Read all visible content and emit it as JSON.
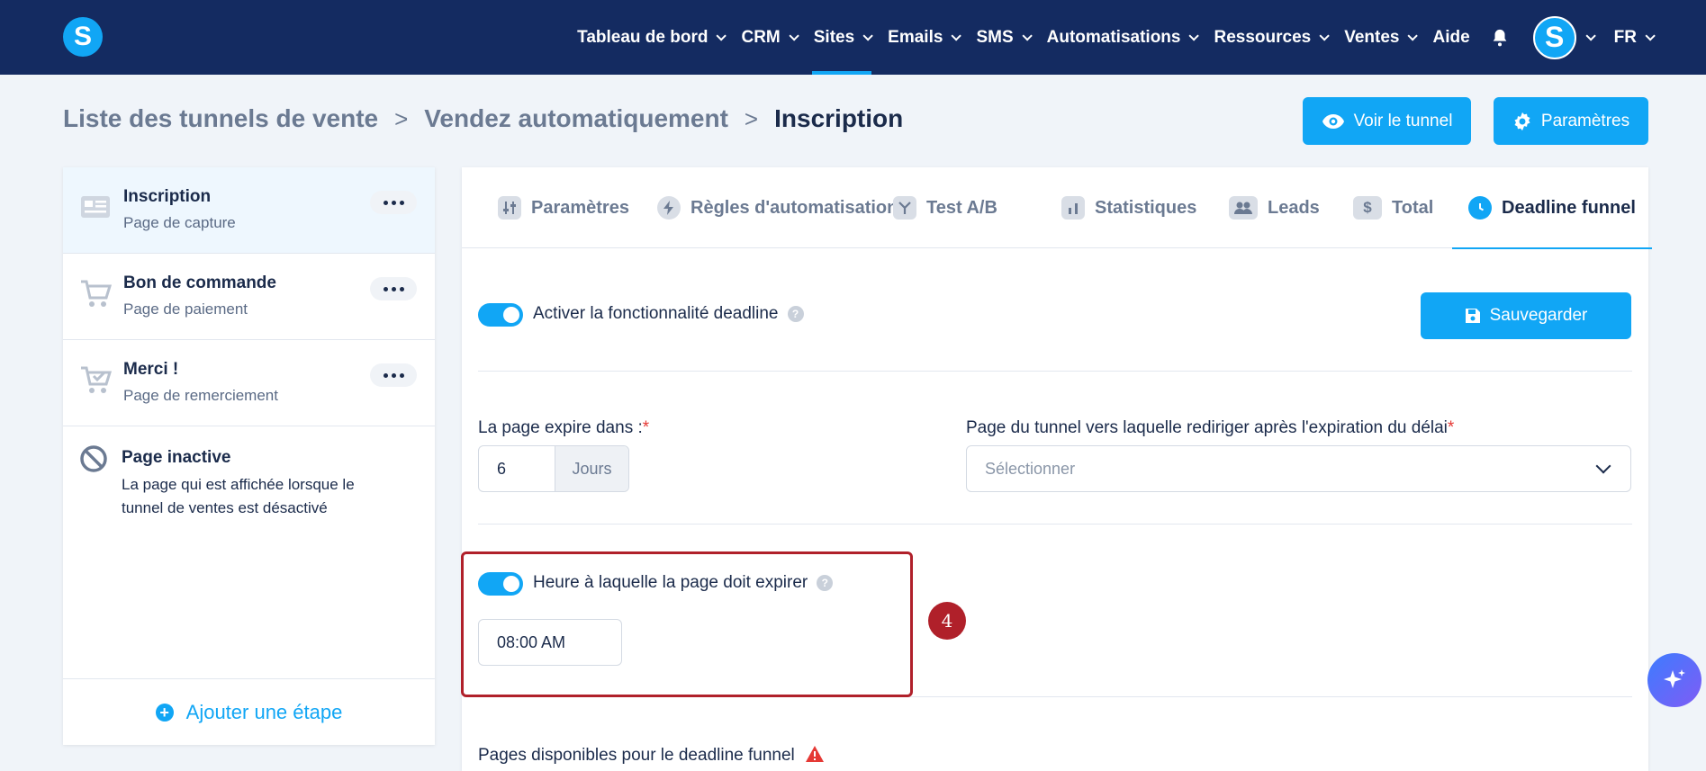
{
  "brand": {
    "logo_letter": "S",
    "accent_color": "#11a6f5",
    "nav_bg": "#142b61"
  },
  "nav": {
    "items": [
      {
        "label": "Tableau de bord",
        "has_dropdown": true
      },
      {
        "label": "CRM",
        "has_dropdown": true
      },
      {
        "label": "Sites",
        "has_dropdown": true,
        "active": true
      },
      {
        "label": "Emails",
        "has_dropdown": true
      },
      {
        "label": "SMS",
        "has_dropdown": true
      },
      {
        "label": "Automatisations",
        "has_dropdown": true
      },
      {
        "label": "Ressources",
        "has_dropdown": true
      },
      {
        "label": "Ventes",
        "has_dropdown": true
      },
      {
        "label": "Aide",
        "has_dropdown": false
      }
    ],
    "bell_icon": "bell-icon",
    "avatar_letter": "S",
    "language": "FR"
  },
  "breadcrumb": {
    "items": [
      "Liste des tunnels de vente",
      "Vendez automatiquement",
      "Inscription"
    ],
    "separator": ">"
  },
  "actions": {
    "view_funnel": "Voir le tunnel",
    "settings": "Paramètres"
  },
  "steps": [
    {
      "title": "Inscription",
      "subtitle": "Page de capture",
      "icon": "capture-page-icon",
      "selected": true
    },
    {
      "title": "Bon de commande",
      "subtitle": "Page de paiement",
      "icon": "cart-icon"
    },
    {
      "title": "Merci !",
      "subtitle": "Page de remerciement",
      "icon": "cart-check-icon"
    }
  ],
  "inactive_page": {
    "title": "Page inactive",
    "description": "La page qui est affichée lorsque le tunnel de ventes est désactivé",
    "icon": "ban-icon"
  },
  "add_step_label": "Ajouter une étape",
  "tabs": [
    {
      "label": "Paramètres",
      "icon": "sliders-icon"
    },
    {
      "label": "Règles d'automatisation",
      "icon": "bolt-icon"
    },
    {
      "label": "Test A/B",
      "icon": "split-icon"
    },
    {
      "label": "Statistiques",
      "icon": "bar-chart-icon"
    },
    {
      "label": "Leads",
      "icon": "users-icon"
    },
    {
      "label": "Total",
      "icon": "dollar-icon"
    },
    {
      "label": "Deadline funnel",
      "icon": "clock-icon",
      "active": true
    }
  ],
  "deadline": {
    "enable_label": "Activer la fonctionnalité deadline",
    "enable_on": true,
    "save_label": "Sauvegarder",
    "expires_label": "La page expire dans :",
    "expires_value": "6",
    "expires_unit": "Jours",
    "redirect_label": "Page du tunnel vers laquelle rediriger après l'expiration du délai",
    "redirect_placeholder": "Sélectionner",
    "time_toggle_label": "Heure à laquelle la page doit expirer",
    "time_toggle_on": true,
    "time_value": "08:00 AM",
    "available_pages_label": "Pages disponibles pour le deadline funnel",
    "required_mark": "*",
    "help_mark": "?"
  },
  "annotation": {
    "number": "4",
    "color": "#b0202a"
  }
}
